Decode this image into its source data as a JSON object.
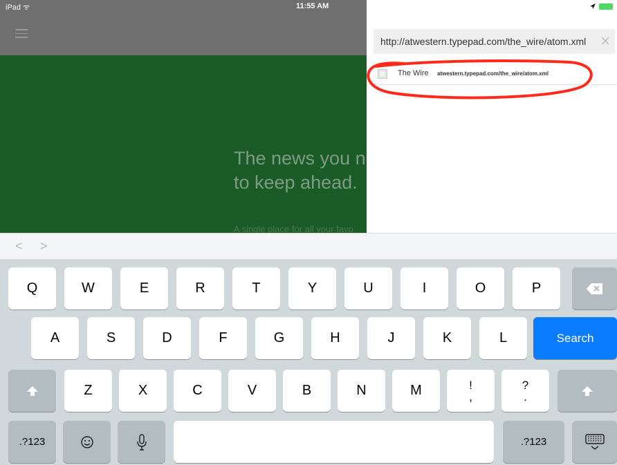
{
  "status_bar": {
    "carrier": "iPad ᯤ",
    "time": "11:55 AM",
    "battery_color": "#4cd964"
  },
  "background_app": {
    "menu_icon": "hamburger-icon",
    "headline_line1": "The news you ne",
    "headline_line2": "to keep ahead.",
    "subtitle": "A single place for all your favo",
    "hero_color": "#1b5b27"
  },
  "search_panel": {
    "url_value": "http://atwestern.typepad.com/the_wire/atom.xml",
    "clear_icon": "close-icon",
    "results": [
      {
        "name": "The Wire",
        "url": "atwestern.typepad.com/the_wire/atom.xml"
      }
    ],
    "annotation_color": "#ff2a1a"
  },
  "keyboard": {
    "accessory": {
      "back": "<",
      "forward": ">"
    },
    "row1": [
      "Q",
      "W",
      "E",
      "R",
      "T",
      "Y",
      "U",
      "I",
      "O",
      "P"
    ],
    "row2": [
      "A",
      "S",
      "D",
      "F",
      "G",
      "H",
      "J",
      "K",
      "L"
    ],
    "row3": [
      "Z",
      "X",
      "C",
      "V",
      "B",
      "N",
      "M"
    ],
    "punct1": {
      "top": "!",
      "bottom": ","
    },
    "punct2": {
      "top": "?",
      "bottom": "."
    },
    "search_label": "Search",
    "numbers_label": ".?123",
    "emoji_icon": "emoji-icon",
    "mic_icon": "microphone-icon",
    "backspace_icon": "backspace-icon",
    "shift_icon": "shift-icon",
    "dismiss_icon": "keyboard-dismiss-icon",
    "accent_color": "#0a7cff"
  }
}
